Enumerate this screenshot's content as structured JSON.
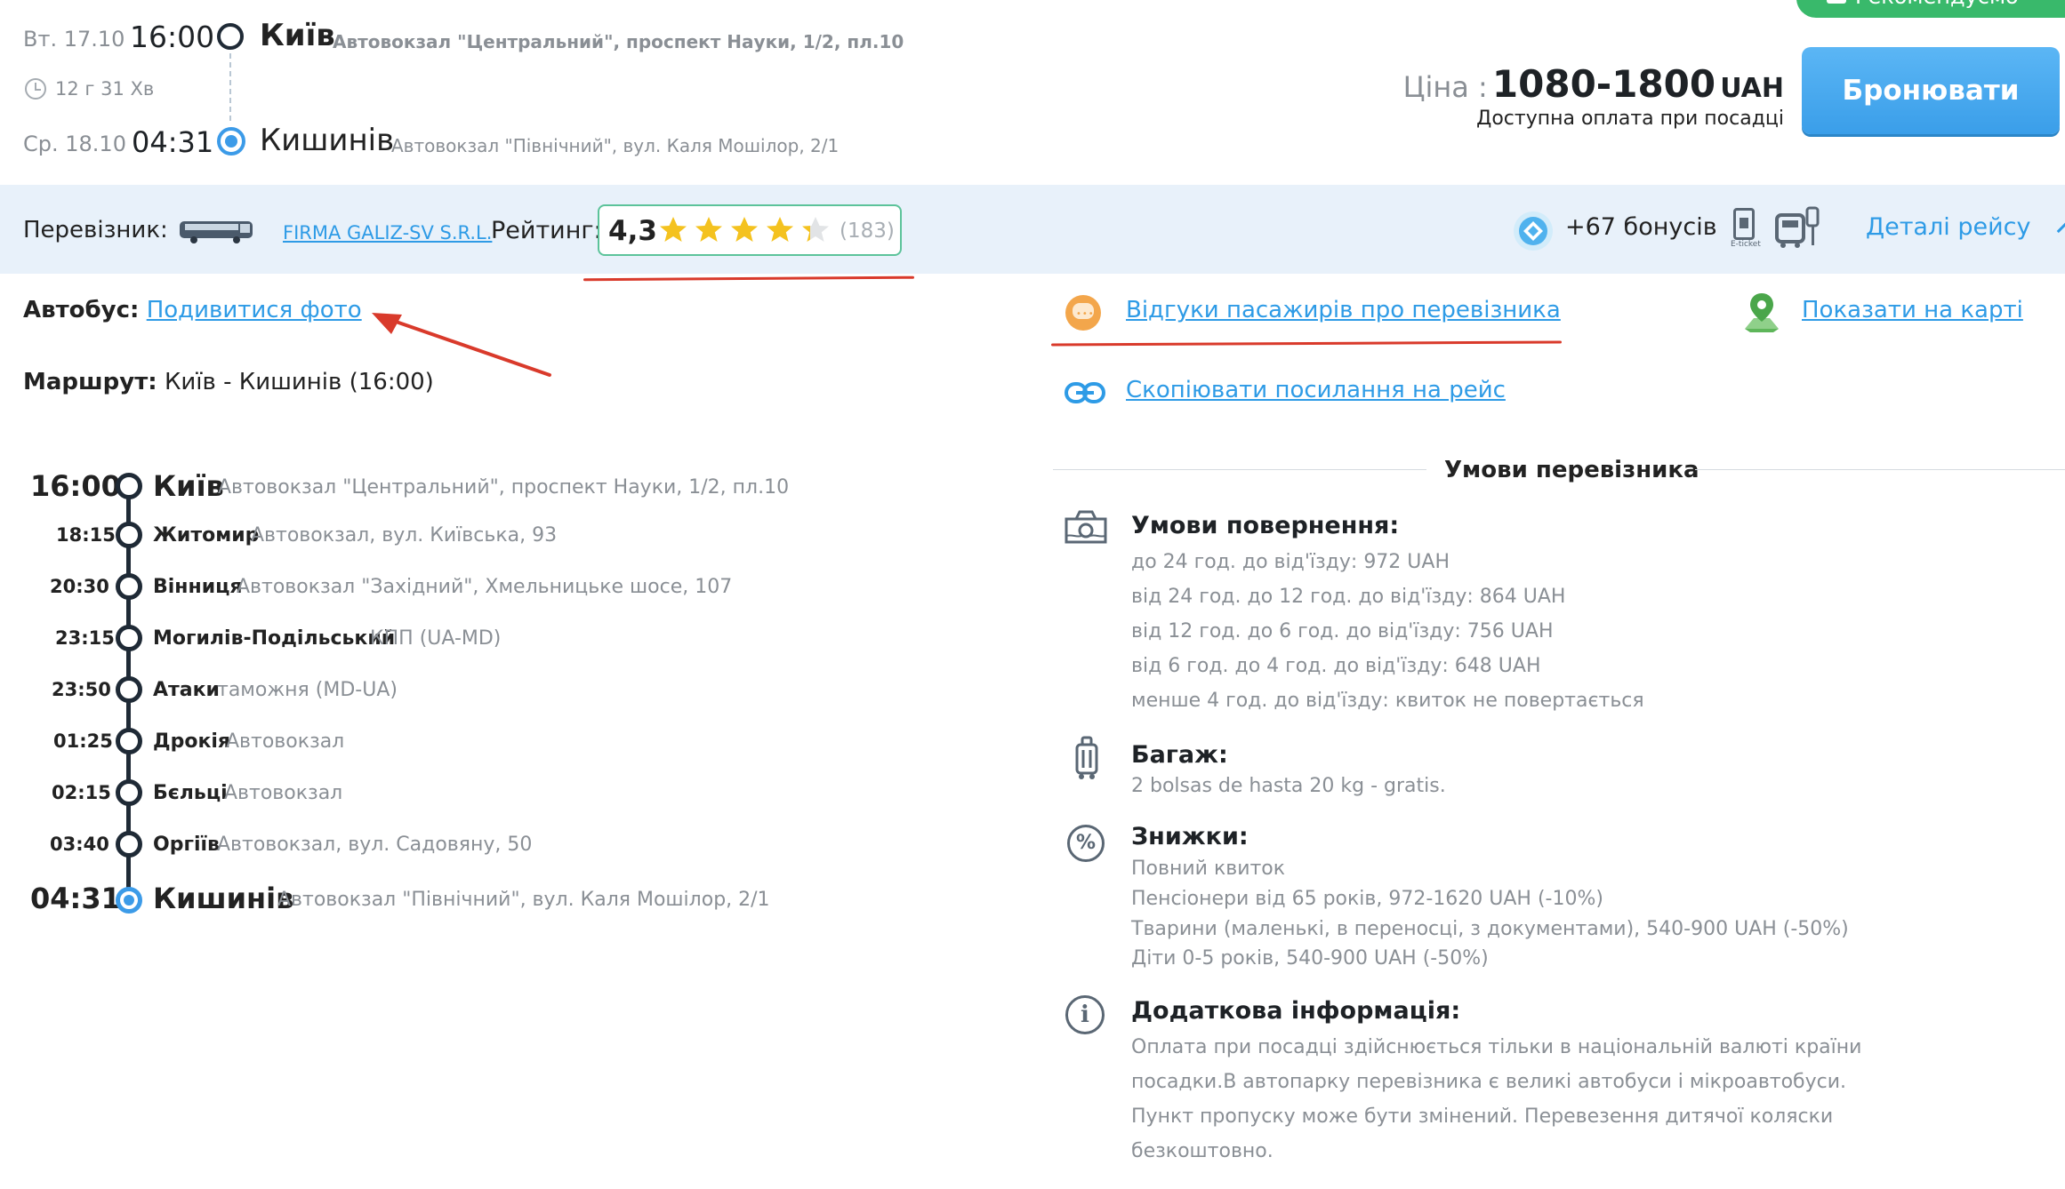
{
  "header": {
    "recommended": "Рекомендуємо",
    "departure": {
      "date": "Вт. 17.10",
      "time": "16:00",
      "city": "Київ",
      "station": "Автовокзал \"Центральний\", проспект Науки, 1/2, пл.10"
    },
    "duration": "12 г 31 Хв",
    "arrival": {
      "date": "Ср. 18.10",
      "time": "04:31",
      "city": "Кишинів",
      "station": "Автовокзал \"Північний\", вул. Каля Мошілор, 2/1"
    },
    "price_label": "Ціна :",
    "price_value": "1080-1800",
    "currency": "UAH",
    "payment_note": "Доступна оплата при посадці",
    "book_label": "Бронювати"
  },
  "carrier": {
    "label": "Перевізник:",
    "name": "FIRMA GALIZ-SV S.R.L.",
    "rating_label": "Рейтинг:",
    "rating_value": "4,3",
    "rating_stars": 4.3,
    "rating_count": "(183)",
    "bonus": "+67 бонусів",
    "eticket_caption": "E-ticket",
    "details_label": "Деталі рейсу"
  },
  "bus": {
    "label": "Автобус:",
    "photo_link": "Подивитися фото"
  },
  "route": {
    "label": "Маршрут:",
    "value": "Київ - Кишинів (16:00)"
  },
  "stops": [
    {
      "time": "16:00",
      "city": "Київ",
      "place": "Автовокзал \"Центральний\", проспект Науки, 1/2, пл.10"
    },
    {
      "time": "18:15",
      "city": "Житомир",
      "place": "Автовокзал, вул. Київська, 93"
    },
    {
      "time": "20:30",
      "city": "Вінниця",
      "place": "Автовокзал \"Західний\", Хмельницьке шосе, 107"
    },
    {
      "time": "23:15",
      "city": "Могилів-Подільський",
      "place": "КПП (UA-MD)"
    },
    {
      "time": "23:50",
      "city": "Атаки",
      "place": "таможня (MD-UA)"
    },
    {
      "time": "01:25",
      "city": "Дрокія",
      "place": "Автовокзал"
    },
    {
      "time": "02:15",
      "city": "Бєльці",
      "place": "Автовокзал"
    },
    {
      "time": "03:40",
      "city": "Оргіїв",
      "place": "Автовокзал, вул. Садовяну, 50"
    },
    {
      "time": "04:31",
      "city": "Кишинів",
      "place": "Автовокзал \"Північний\", вул. Каля Мошілор, 2/1"
    }
  ],
  "links": {
    "reviews": "Відгуки пасажирів про перевізника",
    "map": "Показати на карті",
    "copy": "Скопіювати посилання на рейс"
  },
  "conditions": {
    "title": "Умови перевізника",
    "refund": {
      "title": "Умови повернення:",
      "lines": [
        "до 24 год. до від'їзду: 972 UAH",
        "від 24 год. до 12 год. до від'їзду: 864 UAH",
        "від 12 год. до 6 год. до від'їзду: 756 UAH",
        "від 6 год. до 4 год. до від'їзду: 648 UAH",
        "менше 4 год. до від'їзду: квиток не повертається"
      ]
    },
    "baggage": {
      "title": "Багаж:",
      "lines": [
        "2 bolsas de hasta 20 kg - gratis."
      ]
    },
    "discounts": {
      "title": "Знижки:",
      "lines": [
        "Повний квиток",
        "Пенсіонери від 65 років, 972-1620 UAH (-10%)",
        "Тварини (маленькі, в переносці, з документами), 540-900 UAH (-50%)",
        "Діти 0-5 років, 540-900 UAH (-50%)"
      ]
    },
    "extra": {
      "title": "Додаткова інформація:",
      "lines": [
        "Оплата при посадці здійснюється тільки в національній валюті країни",
        "посадки.В автопарку перевізника є великі автобуси і мікроавтобуси.",
        "Пункт пропуску може бути змінений. Перевезення дитячої коляски",
        "безкоштовно."
      ]
    }
  },
  "colors": {
    "accent": "#2e9be6",
    "annotation": "#d93a2b",
    "band": "#e8f1fa",
    "badge": "#39b96b",
    "star": "#f4c21f"
  }
}
